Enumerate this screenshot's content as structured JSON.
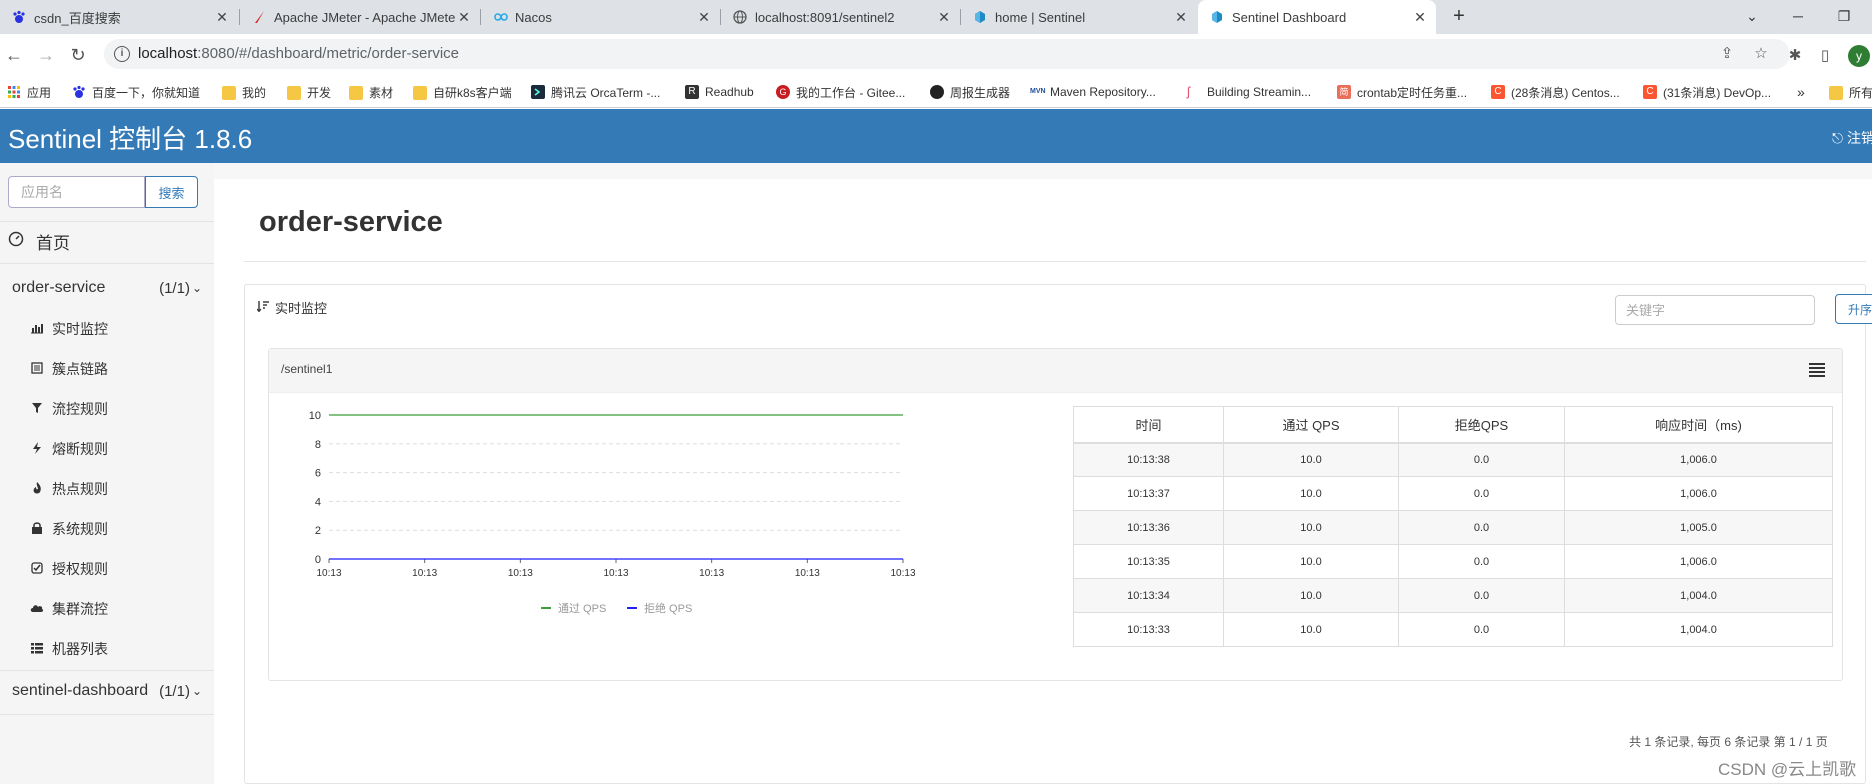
{
  "browser": {
    "tabs": [
      {
        "title": "csdn_百度搜索",
        "icon": "baidu-paw-icon",
        "active": false
      },
      {
        "title": "Apache JMeter - Apache JMeter",
        "icon": "jmeter-feather-icon",
        "active": false
      },
      {
        "title": "Nacos",
        "icon": "nacos-infinity-icon",
        "active": false
      },
      {
        "title": "localhost:8091/sentinel2",
        "icon": "globe-icon",
        "active": false
      },
      {
        "title": "home | Sentinel",
        "icon": "sentinel-icon",
        "active": false
      },
      {
        "title": "Sentinel Dashboard",
        "icon": "sentinel-icon",
        "active": true
      }
    ],
    "url_host": "localhost",
    "url_path": ":8080/#/dashboard/metric/order-service",
    "profile_initial": "y",
    "bookmarks": [
      {
        "label": "应用",
        "icon": "apps-grid-icon"
      },
      {
        "label": "百度一下，你就知道",
        "icon": "baidu-paw-icon"
      },
      {
        "label": "我的",
        "icon": "folder-icon"
      },
      {
        "label": "开发",
        "icon": "folder-icon"
      },
      {
        "label": "素材",
        "icon": "folder-icon"
      },
      {
        "label": "自研k8s客户端",
        "icon": "folder-icon"
      },
      {
        "label": "腾讯云 OrcaTerm -...",
        "icon": "terminal-icon"
      },
      {
        "label": "Readhub",
        "icon": "readhub-icon"
      },
      {
        "label": "我的工作台 - Gitee...",
        "icon": "gitee-icon"
      },
      {
        "label": "周报生成器",
        "icon": "chat-icon"
      },
      {
        "label": "Maven Repository...",
        "icon": "maven-icon"
      },
      {
        "label": "Building Streamin...",
        "icon": "flink-icon"
      },
      {
        "label": "crontab定时任务重...",
        "icon": "jianshu-icon"
      },
      {
        "label": "(28条消息) Centos...",
        "icon": "csdn-icon"
      },
      {
        "label": "(31条消息) DevOp...",
        "icon": "csdn-icon"
      },
      {
        "label": "»",
        "icon": ""
      },
      {
        "label": "所有",
        "icon": "folder-icon"
      }
    ]
  },
  "app": {
    "title": "Sentinel 控制台 1.8.6",
    "logout_label": "注销"
  },
  "sidebar": {
    "search_placeholder": "应用名",
    "search_button": "搜索",
    "home_label": "首页",
    "apps": [
      {
        "name": "order-service",
        "count": "(1/1)"
      },
      {
        "name": "sentinel-dashboard",
        "count": "(1/1)"
      }
    ],
    "menu": [
      {
        "label": "实时监控",
        "icon": "bar-chart-icon"
      },
      {
        "label": "簇点链路",
        "icon": "list-icon"
      },
      {
        "label": "流控规则",
        "icon": "filter-icon"
      },
      {
        "label": "熔断规则",
        "icon": "flash-icon"
      },
      {
        "label": "热点规则",
        "icon": "fire-icon"
      },
      {
        "label": "系统规则",
        "icon": "lock-icon"
      },
      {
        "label": "授权规则",
        "icon": "check-icon"
      },
      {
        "label": "集群流控",
        "icon": "cloud-icon"
      },
      {
        "label": "机器列表",
        "icon": "grid-list-icon"
      }
    ]
  },
  "main": {
    "page_title": "order-service",
    "panel_title": "实时监控",
    "keyword_placeholder": "关键字",
    "sort_button": "升序",
    "resource": "/sentinel1",
    "table": {
      "headers": [
        "时间",
        "通过 QPS",
        "拒绝QPS",
        "响应时间（ms)"
      ],
      "rows": [
        [
          "10:13:38",
          "10.0",
          "0.0",
          "1,006.0"
        ],
        [
          "10:13:37",
          "10.0",
          "0.0",
          "1,006.0"
        ],
        [
          "10:13:36",
          "10.0",
          "0.0",
          "1,005.0"
        ],
        [
          "10:13:35",
          "10.0",
          "0.0",
          "1,006.0"
        ],
        [
          "10:13:34",
          "10.0",
          "0.0",
          "1,004.0"
        ],
        [
          "10:13:33",
          "10.0",
          "0.0",
          "1,004.0"
        ]
      ]
    },
    "pagination": "共 1 条记录, 每页 6 条记录 第 1 / 1 页"
  },
  "chart_data": {
    "type": "line",
    "x": [
      "10:13",
      "10:13",
      "10:13",
      "10:13",
      "10:13",
      "10:13",
      "10:13"
    ],
    "ylim": [
      0,
      10
    ],
    "yticks": [
      0,
      2,
      4,
      6,
      8,
      10
    ],
    "grid": true,
    "legend_position": "bottom",
    "series": [
      {
        "name": "通过 QPS",
        "values": [
          10,
          10,
          10,
          10,
          10,
          10,
          10
        ],
        "color": "#3a9e3a"
      },
      {
        "name": "拒绝 QPS",
        "values": [
          0,
          0,
          0,
          0,
          0,
          0,
          0
        ],
        "color": "#1f1fff"
      }
    ]
  },
  "watermark": "CSDN @云上凯歌",
  "colors": {
    "header_blue": "#337ab7",
    "pass_green": "#3a9e3a",
    "block_blue": "#1f1fff"
  }
}
